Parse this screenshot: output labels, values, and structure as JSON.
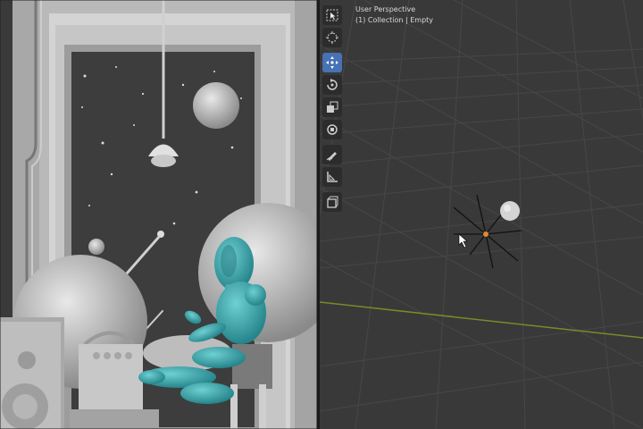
{
  "viewport": {
    "perspective_label": "User Perspective",
    "collection_label": "(1) Collection | Empty"
  },
  "toolbar": {
    "tools": [
      {
        "icon": "select-box-icon",
        "active": false
      },
      {
        "icon": "cursor-icon",
        "active": false
      },
      {
        "icon": "move-icon",
        "active": true
      },
      {
        "icon": "rotate-icon",
        "active": false
      },
      {
        "icon": "scale-icon",
        "active": false
      },
      {
        "icon": "transform-icon",
        "active": false
      },
      {
        "icon": "annotate-icon",
        "active": false
      },
      {
        "icon": "measure-icon",
        "active": false
      },
      {
        "icon": "add-cube-icon",
        "active": false
      }
    ]
  },
  "colors": {
    "active_tool": "#4772b3",
    "x_axis": "#7a8a2a",
    "viewport_bg": "#393939",
    "mannequin": "#3aa3a8"
  }
}
